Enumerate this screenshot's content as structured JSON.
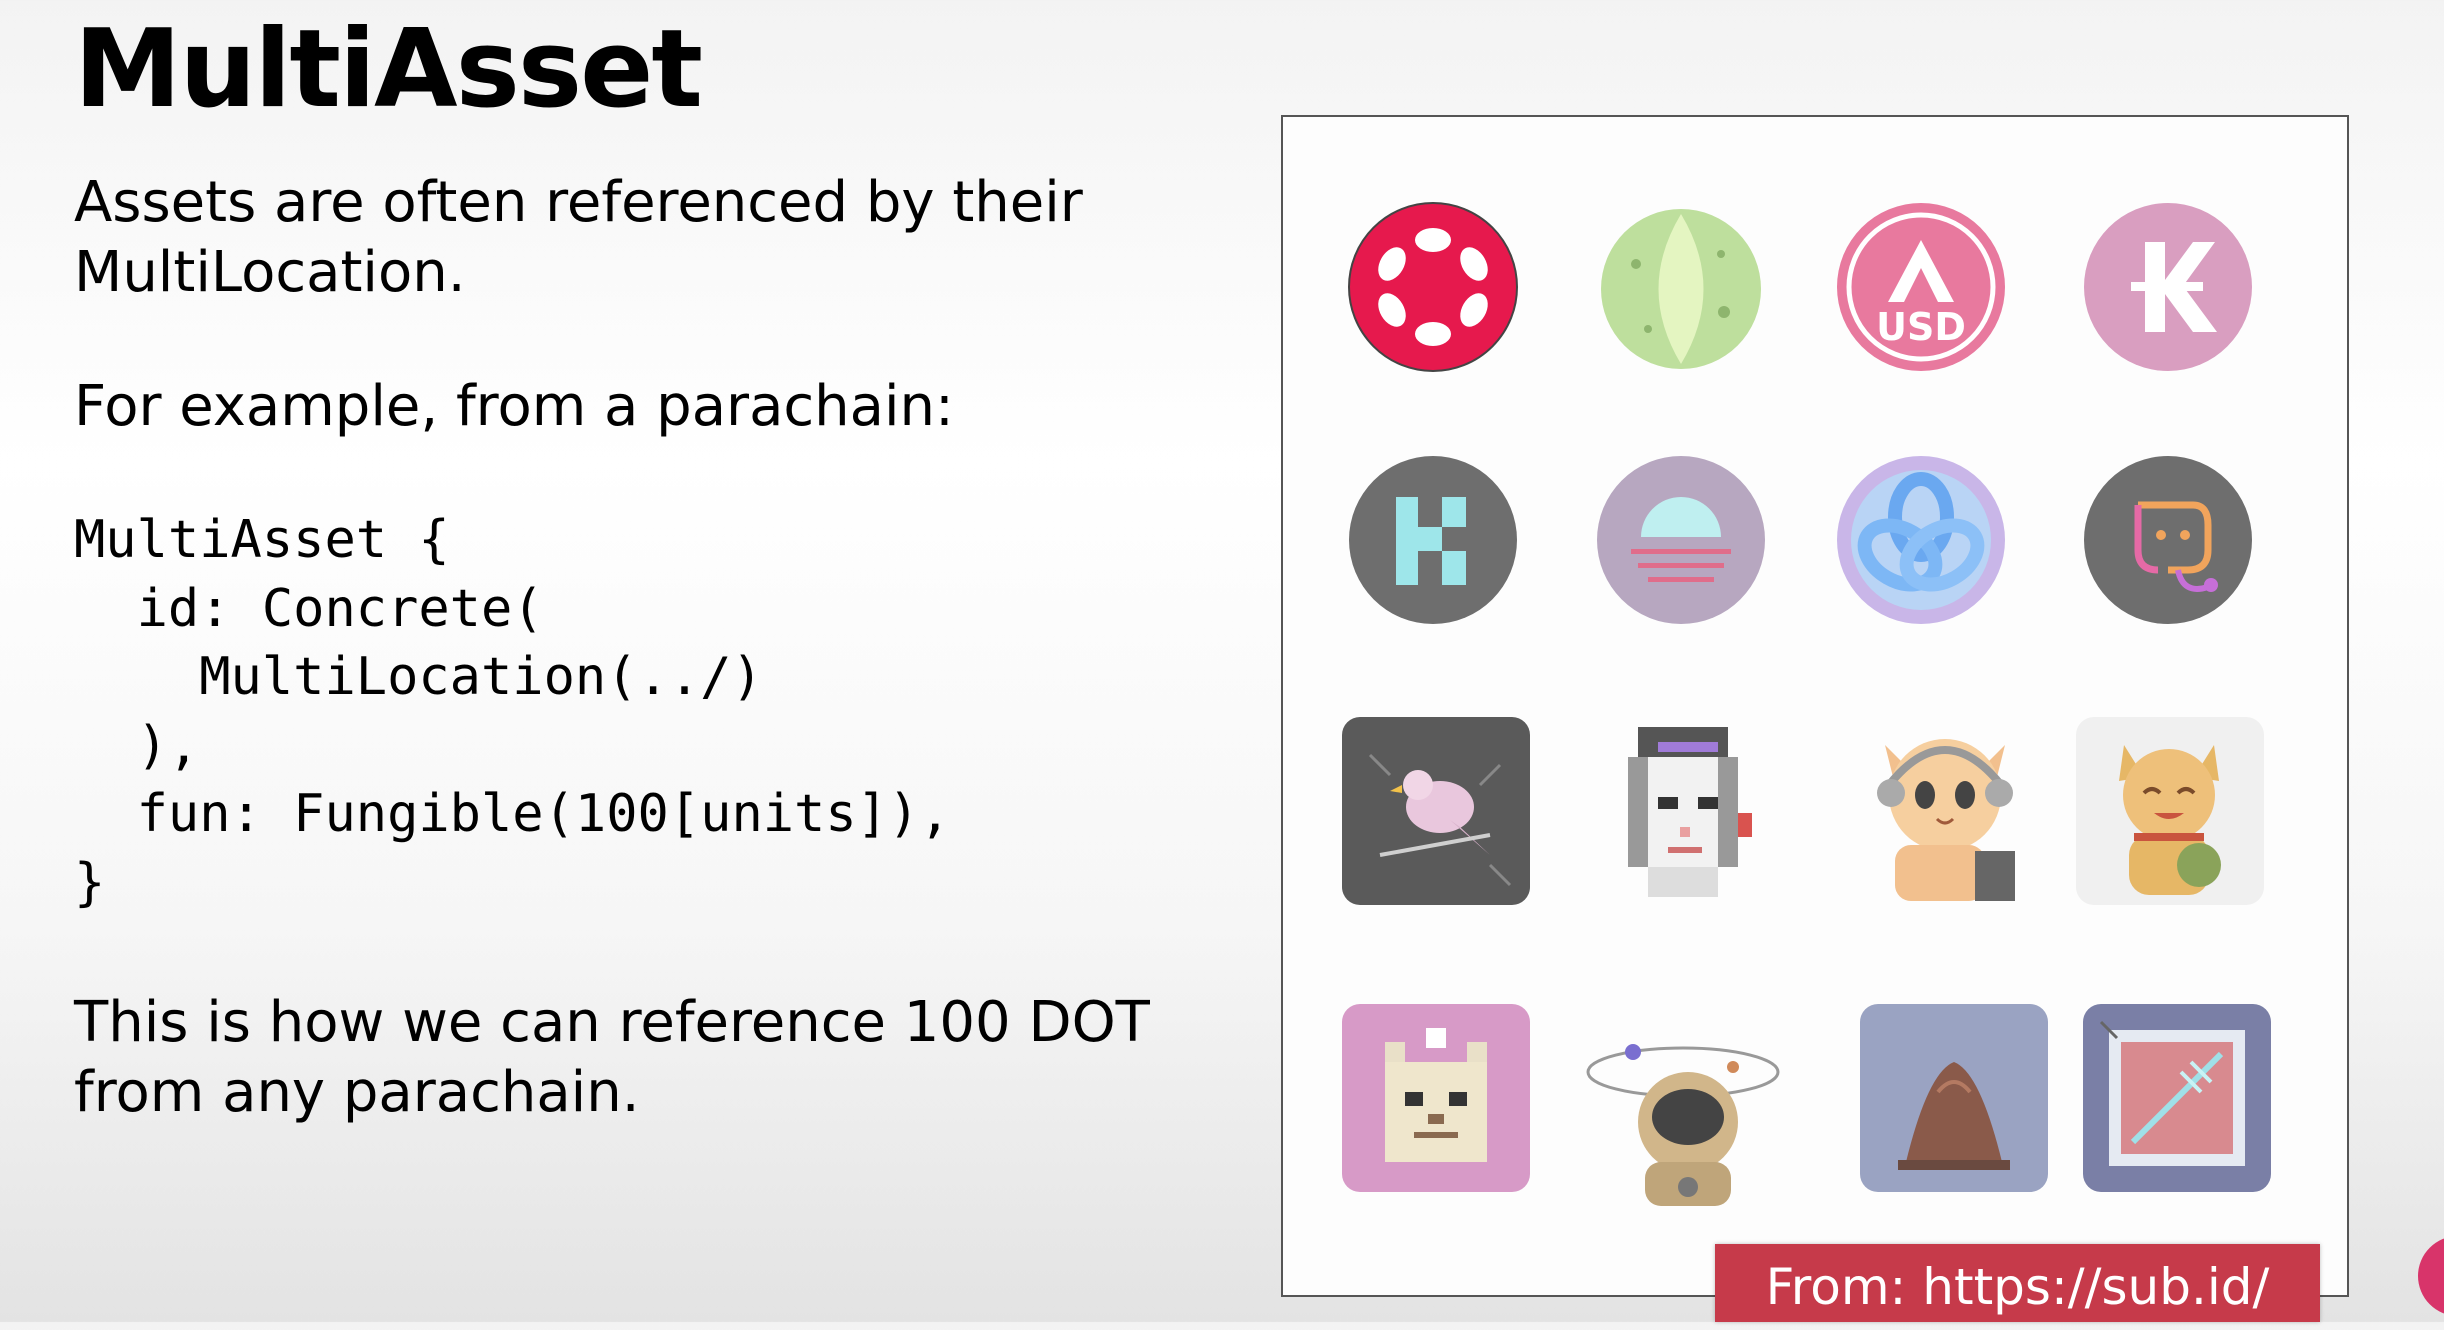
{
  "slide": {
    "title": "MultiAsset",
    "paragraph_1": "Assets are often referenced by their\nMultiLocation.",
    "paragraph_2": "For example, from a parachain:",
    "code": "MultiAsset {\n  id: Concrete(\n    MultiLocation(../)\n  ),\n  fun: Fungible(100[units]),\n}",
    "paragraph_3": "This is how we can reference 100 DOT\nfrom any parachain."
  },
  "panel": {
    "source_label": "From: https://sub.id/",
    "asset_icons": [
      {
        "name": "polkadot-token-icon",
        "color": "#e6194d"
      },
      {
        "name": "green-token-icon",
        "color": "#b9e08a"
      },
      {
        "name": "ausd-token-icon",
        "label": "USD",
        "color": "#e8799e"
      },
      {
        "name": "karura-token-icon",
        "color": "#d99ec0"
      },
      {
        "name": "kilt-token-icon",
        "color": "#6e6e6e"
      },
      {
        "name": "sunset-token-icon",
        "color": "#b7a7c0"
      },
      {
        "name": "knot-token-icon",
        "color": "#8fb6ef"
      },
      {
        "name": "face-token-icon",
        "color": "#6e6e6e"
      },
      {
        "name": "bird-nft-icon",
        "color": "#555555"
      },
      {
        "name": "pixel-punk-nft-icon",
        "color": "#bbbbbb"
      },
      {
        "name": "cat-headphones-nft-icon",
        "color": "#f2c08e"
      },
      {
        "name": "lucky-cat-nft-icon",
        "color": "#e6b766"
      },
      {
        "name": "pixel-cat-nft-icon",
        "color": "#d79ac7"
      },
      {
        "name": "astronaut-nft-icon",
        "color": "#c9a46a"
      },
      {
        "name": "mountain-nft-icon",
        "color": "#9aa3c2"
      },
      {
        "name": "red-box-nft-icon",
        "color": "#d88a8f"
      }
    ]
  }
}
